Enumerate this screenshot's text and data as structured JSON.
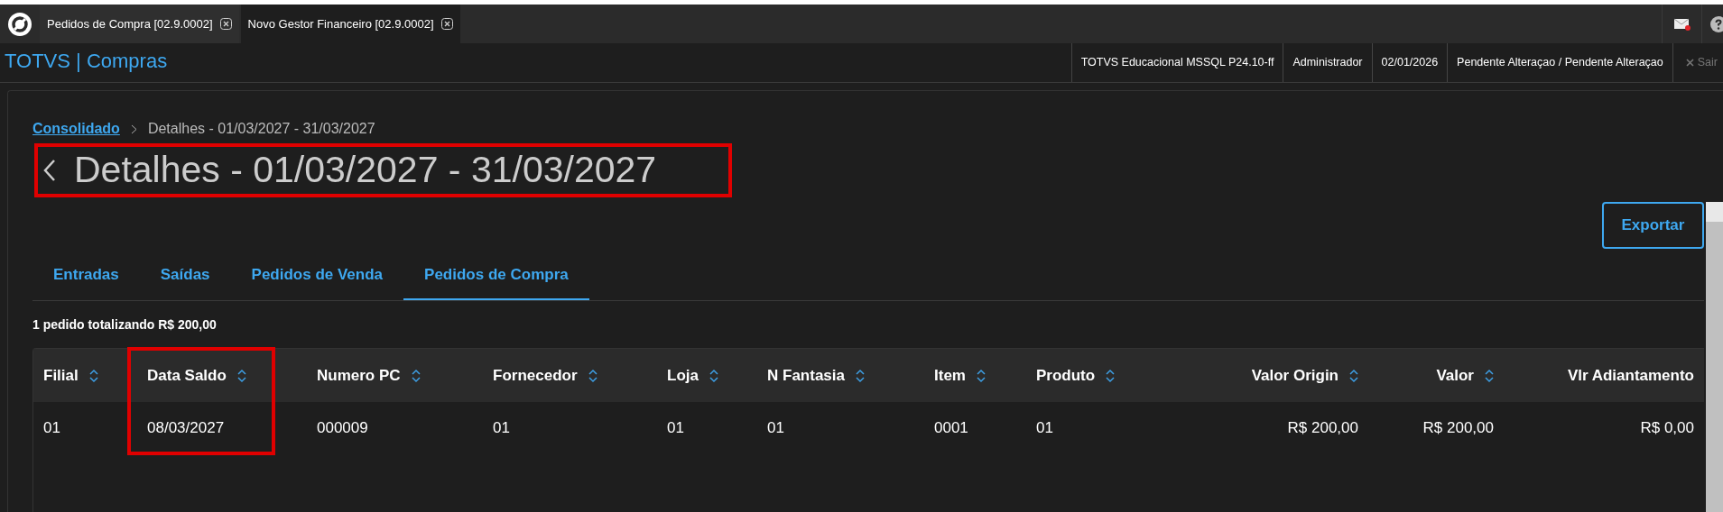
{
  "window_tabs": [
    {
      "label": "Pedidos de Compra [02.9.0002]",
      "selected": false
    },
    {
      "label": "Novo Gestor Financeiro [02.9.0002]",
      "selected": true
    }
  ],
  "app_title": "TOTVS | Compras",
  "header_info": [
    "TOTVS Educacional MSSQL P24.10-ff",
    "Administrador",
    "02/01/2026",
    "Pendente Alteraçao / Pendente Alteraçao"
  ],
  "logout": "Sair",
  "breadcrumb": {
    "link": "Consolidado",
    "current": "Detalhes - 01/03/2027 - 31/03/2027"
  },
  "page_title": "Detalhes - 01/03/2027 - 31/03/2027",
  "export_button": "Exportar",
  "tabs": [
    {
      "label": "Entradas",
      "selected": false
    },
    {
      "label": "Saídas",
      "selected": false
    },
    {
      "label": "Pedidos de Venda",
      "selected": false
    },
    {
      "label": "Pedidos de Compra",
      "selected": true
    }
  ],
  "summary": "1 pedido totalizando R$ 200,00",
  "table": {
    "columns": [
      {
        "label": "Filial",
        "sortable": true
      },
      {
        "label": "Data Saldo",
        "sortable": true
      },
      {
        "label": "Numero PC",
        "sortable": true
      },
      {
        "label": "Fornecedor",
        "sortable": true
      },
      {
        "label": "Loja",
        "sortable": true
      },
      {
        "label": "N Fantasia",
        "sortable": true
      },
      {
        "label": "Item",
        "sortable": true
      },
      {
        "label": "Produto",
        "sortable": true
      },
      {
        "label": "Valor Origin",
        "sortable": true
      },
      {
        "label": "Valor",
        "sortable": true
      },
      {
        "label": "Vlr Adiantamento",
        "sortable": false
      }
    ],
    "rows": [
      [
        "01",
        "08/03/2027",
        "000009",
        "01",
        "01",
        "01",
        "0001",
        "01",
        "R$ 200,00",
        "R$ 200,00",
        "R$ 0,00"
      ]
    ]
  }
}
